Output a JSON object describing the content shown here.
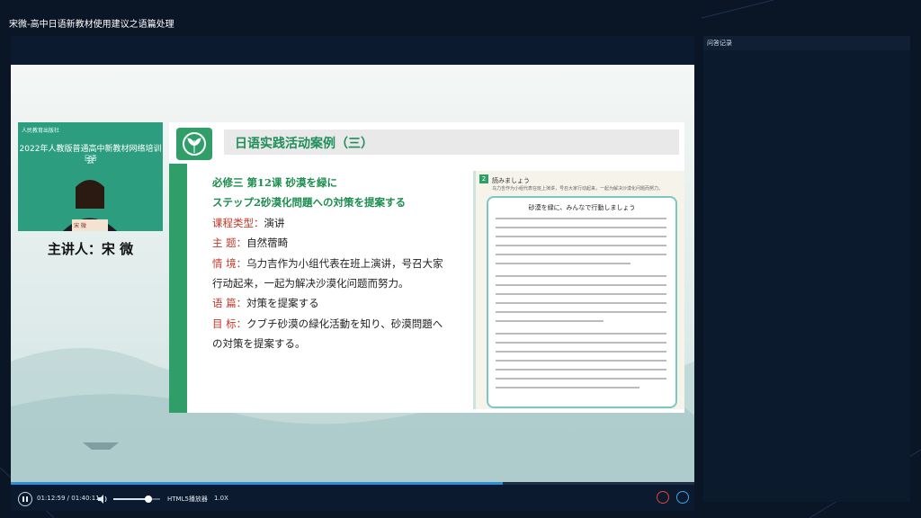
{
  "window": {
    "title": "宋微-高中日语新教材使用建议之语篇处理"
  },
  "camera": {
    "org": "人民教育出版社",
    "banner": "2022年人教版普通高中新教材网络培训会",
    "subject": "日语",
    "nameplate": "宋 微"
  },
  "presenter_label": "主讲人：宋 微",
  "slide": {
    "title": "日语实践活动案例（三）",
    "lines": [
      {
        "label": "",
        "text": "必修三  第12课   砂漠を緑に"
      },
      {
        "label": "",
        "text": "ステップ2砂漠化問題への対策を提案する"
      },
      {
        "label": "课程类型：",
        "text": "演讲"
      },
      {
        "label": "主    题：",
        "text": "自然蓿畸"
      },
      {
        "label": "情    境：",
        "text": "乌力吉作为小组代表在班上演讲，号召大家行动起来，一起为解决沙漠化问题而努力。"
      },
      {
        "label": "语    篇：",
        "text": "対策を提案する"
      },
      {
        "label": "目    标：",
        "text": "クブチ砂漠の緑化活動を知り、砂漠問題への対策を提案する。"
      }
    ],
    "page": {
      "num": "2",
      "section": "読みましょう",
      "intro": "乌力吉作为小组代表在班上演讲，号召大家行动起来，一起为解决沙漠化问题而努力。",
      "box_title": "砂漠を緑に、みんなで行動しましょう"
    }
  },
  "controls": {
    "time": "01:12:59 / 01:40:11",
    "player_type": "HTML5播放器",
    "speed": "1.0X",
    "progress": 0.72,
    "volume": 0.75
  },
  "sidebar": {
    "title": "问答记录"
  }
}
